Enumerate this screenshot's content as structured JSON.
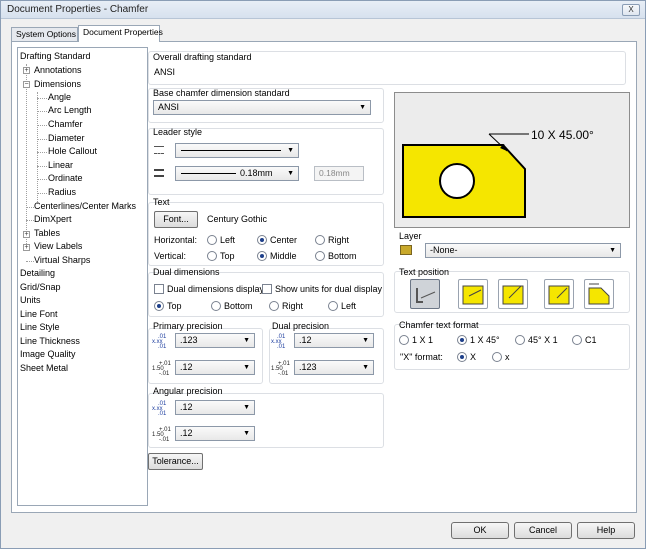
{
  "window": {
    "title": "Document Properties - Chamfer",
    "close_label": "X"
  },
  "tabs": [
    {
      "label": "System Options",
      "active": false
    },
    {
      "label": "Document Properties",
      "active": true
    }
  ],
  "tree": [
    {
      "label": "Drafting Standard"
    },
    {
      "label": "Annotations"
    },
    {
      "label": "Dimensions"
    },
    {
      "label": "Angle"
    },
    {
      "label": "Arc Length"
    },
    {
      "label": "Chamfer",
      "selected": true
    },
    {
      "label": "Diameter"
    },
    {
      "label": "Hole Callout"
    },
    {
      "label": "Linear"
    },
    {
      "label": "Ordinate"
    },
    {
      "label": "Radius"
    },
    {
      "label": "Centerlines/Center Marks"
    },
    {
      "label": "DimXpert"
    },
    {
      "label": "Tables"
    },
    {
      "label": "View Labels"
    },
    {
      "label": "Virtual Sharps"
    },
    {
      "label": "Detailing"
    },
    {
      "label": "Grid/Snap"
    },
    {
      "label": "Units"
    },
    {
      "label": "Line Font"
    },
    {
      "label": "Line Style"
    },
    {
      "label": "Line Thickness"
    },
    {
      "label": "Image Quality"
    },
    {
      "label": "Sheet Metal"
    }
  ],
  "overall": {
    "title": "Overall drafting standard",
    "value": "ANSI"
  },
  "base_chamfer": {
    "title": "Base chamfer dimension standard",
    "value": "ANSI"
  },
  "leader": {
    "title": "Leader style",
    "thickness": "0.18mm",
    "custom_value": "0.18mm"
  },
  "text": {
    "title": "Text",
    "font_button": "Font...",
    "font_name": "Century Gothic",
    "horizontal_label": "Horizontal:",
    "horizontal_options": [
      "Left",
      "Center",
      "Right"
    ],
    "horizontal_selected": 1,
    "vertical_label": "Vertical:",
    "vertical_options": [
      "Top",
      "Middle",
      "Bottom"
    ],
    "vertical_selected": 1
  },
  "dual": {
    "title": "Dual dimensions",
    "display_label": "Dual dimensions display",
    "units_label": "Show units for dual display",
    "position_options": [
      "Top",
      "Bottom",
      "Right",
      "Left"
    ],
    "position_selected": 0
  },
  "primary_precision": {
    "title": "Primary precision",
    "value1": ".123",
    "value2": ".12"
  },
  "dual_precision": {
    "title": "Dual precision",
    "value1": ".12",
    "value2": ".123"
  },
  "angular_precision": {
    "title": "Angular precision",
    "value1": ".12",
    "value2": ".12"
  },
  "tolerance_button": "Tolerance...",
  "precision_icon": {
    "top": ".01",
    "mid": "x.xx",
    "bottom": ".01",
    "alt": "1.50",
    "alt_top": "+.01",
    "alt_bottom": "-.01"
  },
  "preview": {
    "callout": "10 X 45.00°",
    "fill_color": "#f5e600"
  },
  "layer": {
    "title": "Layer",
    "value": "-None-"
  },
  "text_position": {
    "title": "Text position",
    "selected": 0
  },
  "chamfer_format": {
    "title": "Chamfer text format",
    "options": [
      "1 X 1",
      "1 X 45°",
      "45° X 1",
      "C1"
    ],
    "selected": 1,
    "x_format_label": "\"X\" format:",
    "x_options": [
      "X",
      "x"
    ],
    "x_selected": 0
  },
  "footer": {
    "ok": "OK",
    "cancel": "Cancel",
    "help": "Help"
  }
}
